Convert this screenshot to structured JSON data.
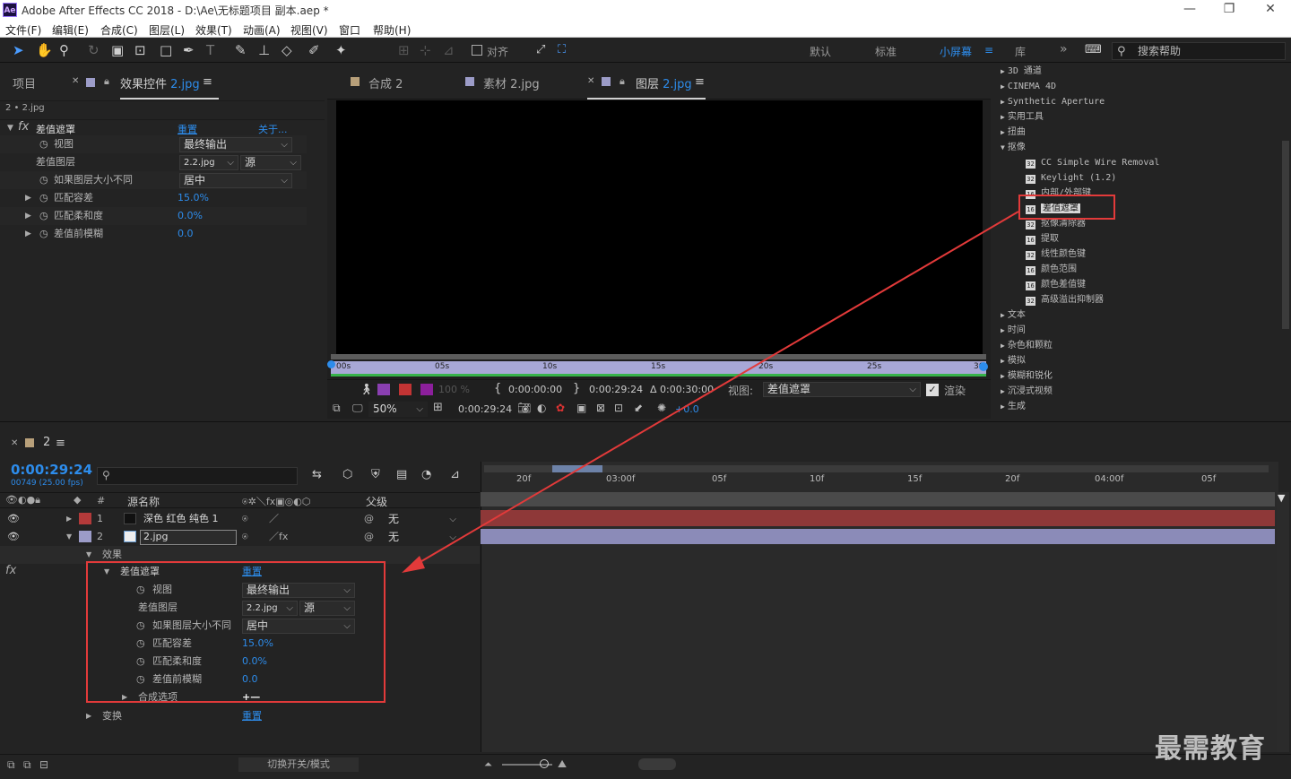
{
  "window": {
    "title": "Adobe After Effects CC 2018 - D:\\Ae\\无标题项目 副本.aep *",
    "logo": "Ae"
  },
  "menu": [
    "文件(F)",
    "编辑(E)",
    "合成(C)",
    "图层(L)",
    "效果(T)",
    "动画(A)",
    "视图(V)",
    "窗口",
    "帮助(H)"
  ],
  "toolbar": {
    "snap_label": "对齐",
    "workspaces": [
      "默认",
      "标准",
      "小屏幕",
      "库"
    ],
    "active_workspace": "小屏幕",
    "search_placeholder": "搜索帮助"
  },
  "left_panel": {
    "tab_project": "项目",
    "tab_effect_controls": "效果控件",
    "tab_effect_target": "2.jpg",
    "layer_path": "2 • 2.jpg",
    "effect_name": "差值遮罩",
    "reset": "重置",
    "about": "关于...",
    "props": [
      {
        "label": "视图",
        "value": "最终输出",
        "kind": "dropdown"
      },
      {
        "label": "差值图层",
        "value": "2.2.jpg",
        "value2": "源",
        "kind": "dropdown2"
      },
      {
        "label": "如果图层大小不同",
        "value": "居中",
        "kind": "dropdown"
      },
      {
        "label": "匹配容差",
        "value": "15.0%",
        "kind": "number"
      },
      {
        "label": "匹配柔和度",
        "value": "0.0%",
        "kind": "number"
      },
      {
        "label": "差值前模糊",
        "value": "0.0",
        "kind": "number"
      }
    ]
  },
  "viewer": {
    "tabs": [
      {
        "label": "合成",
        "name": "2",
        "active": false
      },
      {
        "label": "素材",
        "name": "2.jpg",
        "active": false
      },
      {
        "label": "图层",
        "name": "2.jpg",
        "active": true
      }
    ],
    "ruler": [
      "00s",
      "05s",
      "10s",
      "15s",
      "20s",
      "25s",
      "30"
    ],
    "opacity": "100 %",
    "in_time": "0:00:00:00",
    "out_time": "0:00:29:24",
    "duration": "Δ 0:00:30:00",
    "view_label": "视图:",
    "view_value": "差值遮罩",
    "render_label": "渲染",
    "zoom": "50%",
    "current_time": "0:00:29:24",
    "exposure": "+0.0"
  },
  "effects_panel": {
    "items": [
      {
        "label": "3D 通道",
        "level": 0,
        "arrow": "▶"
      },
      {
        "label": "CINEMA 4D",
        "level": 0,
        "arrow": "▶"
      },
      {
        "label": "Synthetic Aperture",
        "level": 0,
        "arrow": "▶"
      },
      {
        "label": "实用工具",
        "level": 0,
        "arrow": "▶"
      },
      {
        "label": "扭曲",
        "level": 0,
        "arrow": "▶"
      },
      {
        "label": "抠像",
        "level": 0,
        "arrow": "▼"
      },
      {
        "label": "CC Simple Wire Removal",
        "level": 1,
        "badge": "32"
      },
      {
        "label": "Keylight (1.2)",
        "level": 1,
        "badge": "32"
      },
      {
        "label": "内部/外部键",
        "level": 1,
        "badge": "16"
      },
      {
        "label": "差值遮罩",
        "level": 1,
        "badge": "16",
        "selected": true
      },
      {
        "label": "抠像清除器",
        "level": 1,
        "badge": "32"
      },
      {
        "label": "提取",
        "level": 1,
        "badge": "16"
      },
      {
        "label": "线性颜色键",
        "level": 1,
        "badge": "32"
      },
      {
        "label": "颜色范围",
        "level": 1,
        "badge": "16"
      },
      {
        "label": "颜色差值键",
        "level": 1,
        "badge": "16"
      },
      {
        "label": "高级溢出抑制器",
        "level": 1,
        "badge": "32"
      },
      {
        "label": "文本",
        "level": 0,
        "arrow": "▶"
      },
      {
        "label": "时间",
        "level": 0,
        "arrow": "▶"
      },
      {
        "label": "杂色和颗粒",
        "level": 0,
        "arrow": "▶"
      },
      {
        "label": "模拟",
        "level": 0,
        "arrow": "▶"
      },
      {
        "label": "模糊和锐化",
        "level": 0,
        "arrow": "▶"
      },
      {
        "label": "沉浸式视频",
        "level": 0,
        "arrow": "▶"
      },
      {
        "label": "生成",
        "level": 0,
        "arrow": "▶"
      }
    ]
  },
  "timeline": {
    "comp_tab": "2",
    "timecode": "0:00:29:24",
    "frames": "00749 (25.00 fps)",
    "col_num": "#",
    "col_source": "源名称",
    "col_parent": "父级",
    "ruler": [
      "20f",
      "03:00f",
      "05f",
      "10f",
      "15f",
      "20f",
      "04:00f",
      "05f"
    ],
    "layers": [
      {
        "num": "1",
        "name": "深色 红色 纯色 1",
        "parent": "无",
        "color": "#b33a3a"
      },
      {
        "num": "2",
        "name": "2.jpg",
        "parent": "无",
        "color": "#9c9cc8"
      }
    ],
    "effects_group": "效果",
    "effect_name": "差值遮罩",
    "reset": "重置",
    "props": [
      {
        "label": "视图",
        "value": "最终输出"
      },
      {
        "label": "差值图层",
        "value": "2.2.jpg",
        "value2": "源"
      },
      {
        "label": "如果图层大小不同",
        "value": "居中"
      },
      {
        "label": "匹配容差",
        "value": "15.0%"
      },
      {
        "label": "匹配柔和度",
        "value": "0.0%"
      },
      {
        "label": "差值前模糊",
        "value": "0.0"
      }
    ],
    "comp_options": "合成选项",
    "comp_options_value": "+—",
    "transform": "变换",
    "transform_reset": "重置",
    "toggle_modes": "切换开关/模式"
  },
  "watermark": "最需教育"
}
